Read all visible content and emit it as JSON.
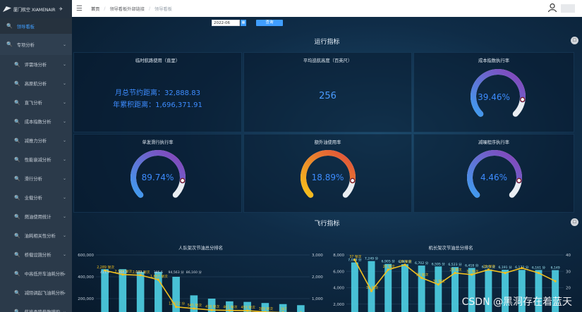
{
  "brand": {
    "name": "厦门航空 XIAMENAIR"
  },
  "sidebar": {
    "items": [
      {
        "label": "领导看板",
        "active": true
      },
      {
        "label": "专项分析",
        "parent": true
      },
      {
        "label": "评需场分析"
      },
      {
        "label": "高原航分析"
      },
      {
        "label": "直飞分析"
      },
      {
        "label": "成本指数分析"
      },
      {
        "label": "减推力分析"
      },
      {
        "label": "性能衰减分析"
      },
      {
        "label": "滑行分析"
      },
      {
        "label": "业载分析"
      },
      {
        "label": "燃油使用统计"
      },
      {
        "label": "油耗相关性分析"
      },
      {
        "label": "桥载设施分析"
      },
      {
        "label": "中高低开车油耗分析"
      },
      {
        "label": "减阻调起飞油耗分析"
      },
      {
        "label": "航班类降载数增抑"
      }
    ]
  },
  "breadcrumb": {
    "home": "首页",
    "parent": "领导看板外部链接",
    "current": "领导看板"
  },
  "filter": {
    "date": "2022-06",
    "query": "查询"
  },
  "ops": {
    "title": "运行指标",
    "card_direct": {
      "title": "临时航路使用（直里）",
      "monthly": "月总节约距离：32,888.83",
      "yearly": "年累积距离：1,696,371.91"
    },
    "card_alt": {
      "title": "平均巡航高度（百英尺）",
      "value": "256"
    },
    "card_cost": {
      "title": "成本指数执行率",
      "value": "39.46%",
      "pct": 39.46
    },
    "card_single": {
      "title": "单发滑行执行率",
      "value": "89.74%",
      "pct": 89.74
    },
    "card_apu": {
      "title": "额外油使用率",
      "value": "18.89%",
      "pct": 18.89
    },
    "card_reduce": {
      "title": "减噪程序执行率",
      "value": "4.46%",
      "pct": 4.46
    }
  },
  "flight": {
    "title": "飞行指标",
    "left_title": "人队架次节油总分排名",
    "right_title": "机长架次节油总分排名"
  },
  "side_buttons": {
    "top": "☐",
    "bottom": "☐"
  },
  "watermark": "CSDN @黑洞存在着蓝天",
  "colors": {
    "accent": "#409eff",
    "gauge_blue": "#3f9df0",
    "gauge_purple": "#8a3fb6",
    "apu_yellow": "#f6c21b",
    "apu_red": "#e04b3c",
    "bar_cyan": "#4fd2e6",
    "line_yellow": "#f2c01e"
  },
  "chart_data": [
    {
      "type": "bar",
      "title": "人队架次节油总分排名",
      "yaxis_left": {
        "ticks": [
          "600,000",
          "400,000",
          "200,000"
        ],
        "ylim": [
          0,
          600000
        ]
      },
      "yaxis_right": {
        "ticks": [
          "3,000",
          "2,000",
          "1,000"
        ],
        "ylim": [
          0,
          3000
        ]
      },
      "series": [
        {
          "values": [
            470000,
            470000,
            445000,
            445000,
            400000,
            230000,
            200000,
            175000,
            170000,
            160000,
            150000,
            140000
          ]
        },
        {
          "line": true,
          "values": [
            2289,
            2104,
            2072,
            1867,
            622,
            545,
            478,
            461,
            450,
            389,
            367,
            360
          ]
        }
      ],
      "point_labels": [
        "2,289 架次",
        "2,104 架次",
        "2,072 架次",
        "1,867 架次",
        "12,622 分",
        "545 架次",
        "478 架次",
        "461 架次",
        "450 架次",
        "389 架次",
        "367"
      ],
      "note_labels": [
        "411,9",
        "364,2",
        "369,1",
        "385,5",
        "94,563 分",
        "86,160 分"
      ]
    },
    {
      "type": "bar",
      "title": "机长架次节油总分排名",
      "yaxis_left": {
        "ticks": [
          "8,000",
          "6,000",
          "4,000",
          "2,000"
        ],
        "ylim": [
          0,
          8000
        ]
      },
      "yaxis_right": {
        "ticks": [
          "40",
          "30",
          "20"
        ],
        "ylim": [
          0,
          40
        ]
      },
      "series": [
        {
          "values": [
            7089,
            7249,
            6905,
            6869,
            6702,
            6595,
            6523,
            6418,
            6223,
            6191,
            6173,
            6161,
            6149
          ]
        },
        {
          "line": true,
          "values": [
            37,
            18,
            31,
            34,
            26,
            22,
            29,
            28,
            31,
            29,
            32,
            29,
            24
          ]
        }
      ],
      "point_labels": [
        "37 架次",
        "31 架次",
        "26 架次",
        "29 架次",
        "28 架次",
        "31 架次",
        "29 架次",
        "32 架次",
        "29 架次"
      ],
      "value_labels": [
        "7,089 分",
        "7,249 分",
        "6,905 分",
        "6,869 分",
        "6,702 分",
        "6,595 分",
        "6,523 分",
        "6,418 分",
        "6,223 分",
        "6,191 分",
        "6,173 分",
        "6,161 分",
        "6,149"
      ]
    }
  ]
}
